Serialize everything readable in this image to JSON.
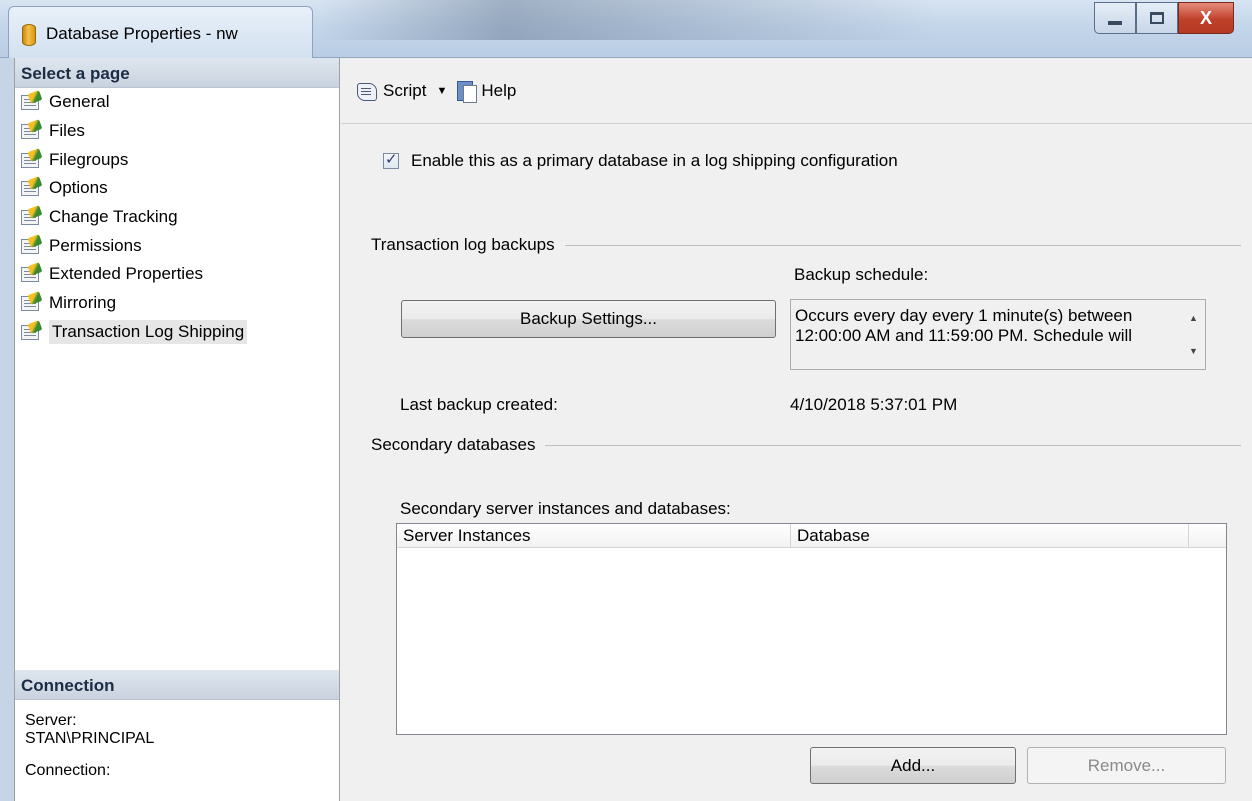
{
  "window": {
    "title": "Database Properties - nw"
  },
  "sidebar": {
    "header": "Select a page",
    "items": [
      {
        "label": "General"
      },
      {
        "label": "Files"
      },
      {
        "label": "Filegroups"
      },
      {
        "label": "Options"
      },
      {
        "label": "Change Tracking"
      },
      {
        "label": "Permissions"
      },
      {
        "label": "Extended Properties"
      },
      {
        "label": "Mirroring"
      },
      {
        "label": "Transaction Log Shipping",
        "selected": true
      }
    ],
    "connection_header": "Connection",
    "server_label": "Server:",
    "server_value": "STAN\\PRINCIPAL",
    "connection_label": "Connection:"
  },
  "toolbar": {
    "script_label": "Script",
    "help_label": "Help"
  },
  "main": {
    "enable_checkbox_label": "Enable this as a primary database in a log shipping configuration",
    "enable_checked": true,
    "transaction_group": "Transaction log backups",
    "backup_schedule_label": "Backup schedule:",
    "backup_settings_button": "Backup Settings...",
    "schedule_text": "Occurs every day every 1 minute(s) between 12:00:00 AM and 11:59:00 PM. Schedule will",
    "last_backup_label": "Last backup created:",
    "last_backup_value": "4/10/2018 5:37:01 PM",
    "secondary_group": "Secondary databases",
    "secondary_list_label": "Secondary server instances and databases:",
    "columns": [
      "Server Instances",
      "Database"
    ],
    "add_button": "Add...",
    "remove_button": "Remove..."
  }
}
